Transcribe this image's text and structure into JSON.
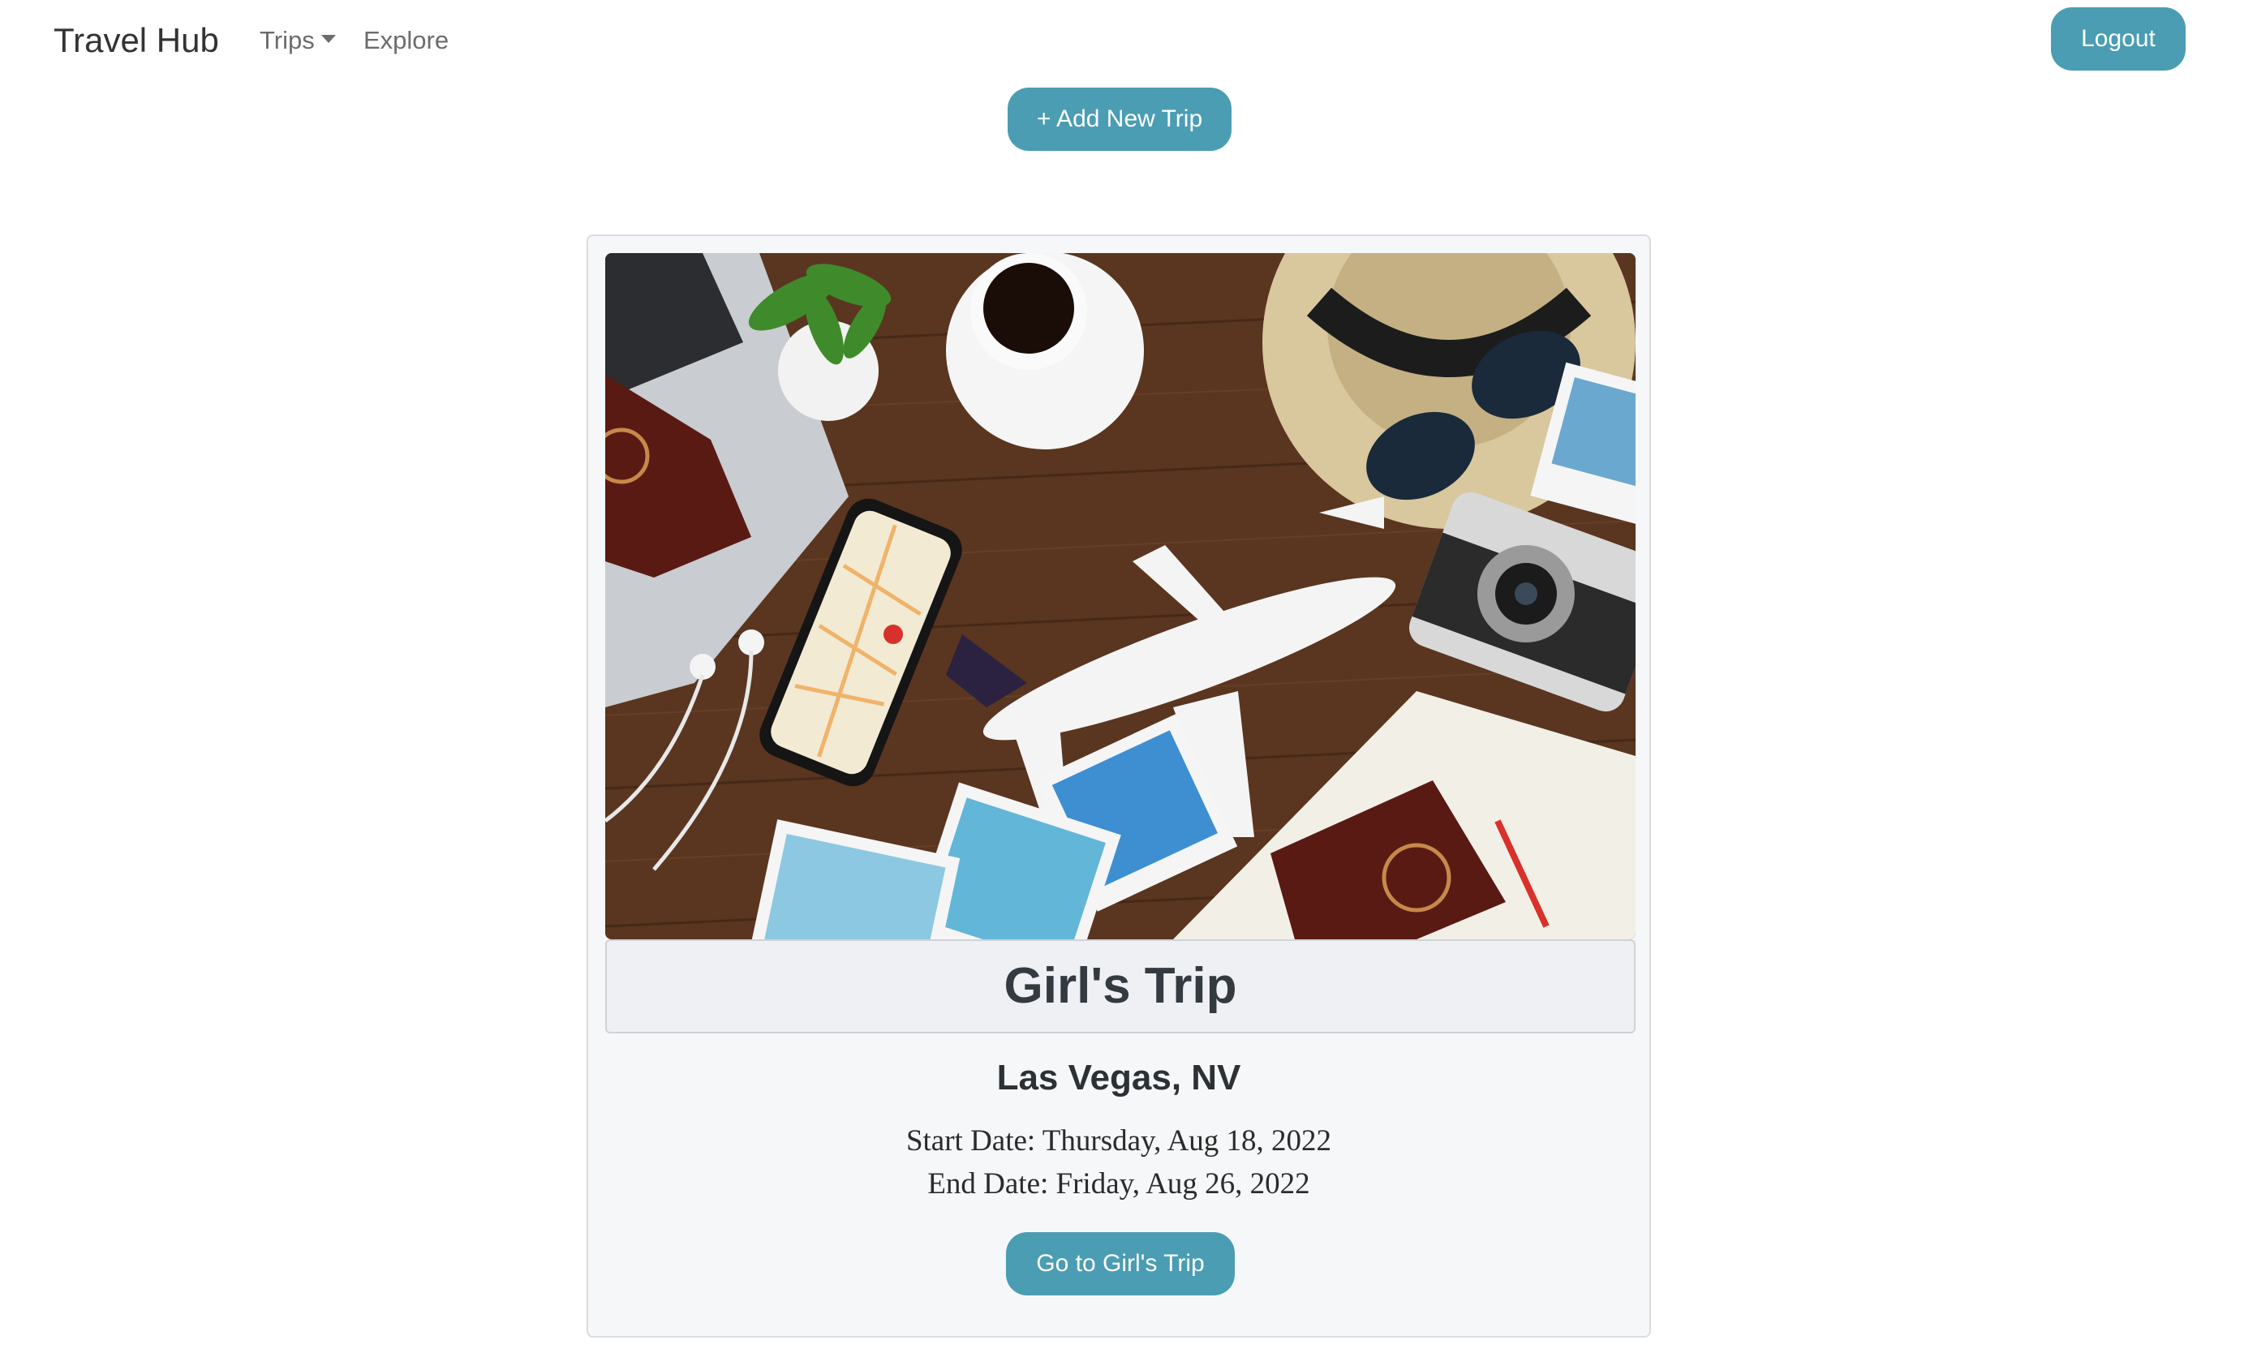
{
  "navbar": {
    "brand": "Travel Hub",
    "trips_label": "Trips",
    "explore_label": "Explore",
    "logout_label": "Logout"
  },
  "actions": {
    "add_trip_label": "+ Add New Trip"
  },
  "trip_card": {
    "title": "Girl's Trip",
    "location": "Las Vegas, NV",
    "start_date": "Start Date: Thursday, Aug 18, 2022",
    "end_date": "End Date: Friday, Aug 26, 2022",
    "go_button_label": "Go to Girl's Trip"
  },
  "colors": {
    "accent": "#4a9db3",
    "card_background": "#f6f7f9",
    "title_background": "#eef0f3"
  }
}
